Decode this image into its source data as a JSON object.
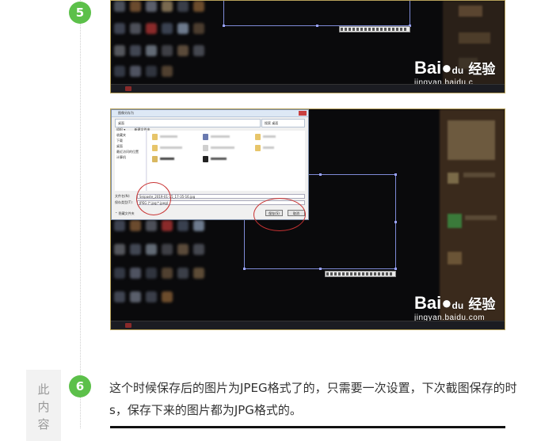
{
  "steps": [
    {
      "number": "5"
    },
    {
      "number": "6",
      "text": "这个时候保存后的图片为JPEG格式了的，只需要一次设置，下次截图保存的时候，s，保存下来的图片都为JPG格式的。",
      "line1": "这个时候保存后的图片为JPEG格式了的，只需要一次设置，下次截图保存的时",
      "line2": "s，保存下来的图片都为JPG格式的。"
    }
  ],
  "watermark": {
    "logo": "Bai",
    "logo_paw": "du",
    "logo_cn": "经验",
    "url": "jingyan.baidu.com"
  },
  "watermark_top": {
    "url": "jingyan.baidu.c"
  },
  "dialog": {
    "title": "图像另存为",
    "address": "桌面",
    "search": "搜索 桌面",
    "toolbar_organize": "组织 ▾",
    "toolbar_new_folder": "新建文件夹",
    "sidebar": [
      "收藏夹",
      "下载",
      "桌面",
      "最近访问的位置",
      "",
      "计算机"
    ],
    "filename_label": "文件名(N):",
    "filename_value": "Snipaste_2019-01-15_17-35-16.jpg",
    "filetype_label": "保存类型(T):",
    "filetype_value": "JPEG (*.jpg;*.jpeg)",
    "hide_folders": "隐藏文件夹",
    "save_button": "保存(S)",
    "cancel_button": "取消"
  },
  "side_tab": {
    "chars": [
      "此",
      "内",
      "容"
    ]
  },
  "colors": {
    "badge": "#5cc04a",
    "annotation": "#c83232",
    "selection": "#7f8bd8"
  }
}
